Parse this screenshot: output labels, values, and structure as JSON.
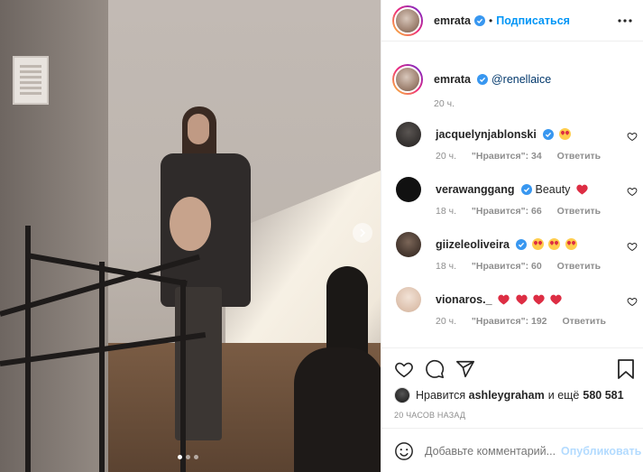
{
  "post": {
    "author": "emrata",
    "follow_label": "Подписаться",
    "separator": "•",
    "caption_mention": "@renellaice",
    "caption_time": "20 ч.",
    "carousel": {
      "total_slides": 3,
      "active_slide": 1
    }
  },
  "comments": [
    {
      "user": "jacquelynjablonski",
      "text": "",
      "emojis": [
        "heart-eyes-emoji"
      ],
      "time": "20 ч.",
      "likes": "\"Нравится\": 34",
      "reply": "Ответить",
      "avatar_color": "#3a3a3a"
    },
    {
      "user": "verawanggang",
      "text": "Beauty",
      "emojis": [
        "red-heart-emoji"
      ],
      "time": "18 ч.",
      "likes": "\"Нравится\": 66",
      "reply": "Ответить",
      "avatar_color": "#111111"
    },
    {
      "user": "giizeleoliveira",
      "text": "",
      "emojis": [
        "heart-eyes-emoji",
        "heart-eyes-emoji",
        "heart-eyes-emoji"
      ],
      "time": "18 ч.",
      "likes": "\"Нравится\": 60",
      "reply": "Ответить",
      "avatar_color": "#5a4a44"
    },
    {
      "user": "vionaros._",
      "text": "",
      "emojis": [
        "heart-emoji",
        "heart-emoji",
        "heart-emoji",
        "heart-emoji"
      ],
      "time": "20 ч.",
      "likes": "\"Нравится\": 192",
      "reply": "Ответить",
      "avatar_color": "#e8d6c8"
    }
  ],
  "likes": {
    "prefix": "Нравится",
    "user": "ashleygraham",
    "conj": "и ещё",
    "count": "580 581"
  },
  "post_date": "20 ЧАСОВ НАЗАД",
  "add_comment": {
    "placeholder": "Добавьте комментарий...",
    "publish_label": "Опубликовать"
  },
  "colors": {
    "accent": "#0095f6",
    "verified": "#3897f0",
    "muted": "#8e8e8e",
    "publish_disabled": "#b3dbff"
  }
}
